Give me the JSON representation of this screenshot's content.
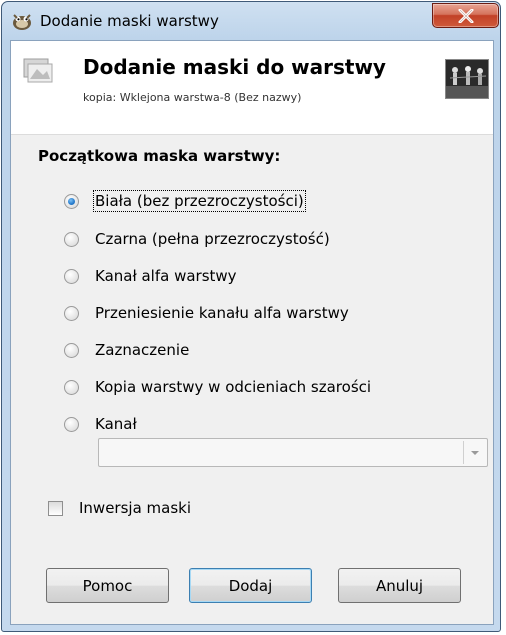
{
  "window": {
    "title": "Dodanie maski warstwy"
  },
  "header": {
    "title": "Dodanie maski do warstwy",
    "subtitle": "kopia: Wklejona warstwa-8 (Bez nazwy)"
  },
  "mask_options": {
    "label": "Początkowa maska warstwy:",
    "items": [
      {
        "text": "Biała (bez przezroczystości)",
        "checked": true
      },
      {
        "text": "Czarna (pełna przezroczystość)",
        "checked": false
      },
      {
        "text": "Kanał alfa warstwy",
        "checked": false
      },
      {
        "text": "Przeniesienie kanału alfa warstwy",
        "checked": false
      },
      {
        "text": "Zaznaczenie",
        "checked": false
      },
      {
        "text": "Kopia warstwy w odcieniach szarości",
        "checked": false
      },
      {
        "text": "Kanał",
        "checked": false
      }
    ]
  },
  "channel_select": {
    "value": ""
  },
  "invert": {
    "label": "Inwersja maski",
    "checked": false
  },
  "buttons": {
    "help": "Pomoc",
    "add": "Dodaj",
    "cancel": "Anuluj"
  },
  "colors": {
    "radio_selected": "#2a7fcf",
    "close_button": "#c24127",
    "title_bar": "#bcd3ea"
  },
  "icons": {
    "app": "gimp-wilber-icon",
    "header": "layer-mask-icon",
    "close": "close-icon",
    "dropdown": "chevron-down-icon"
  }
}
